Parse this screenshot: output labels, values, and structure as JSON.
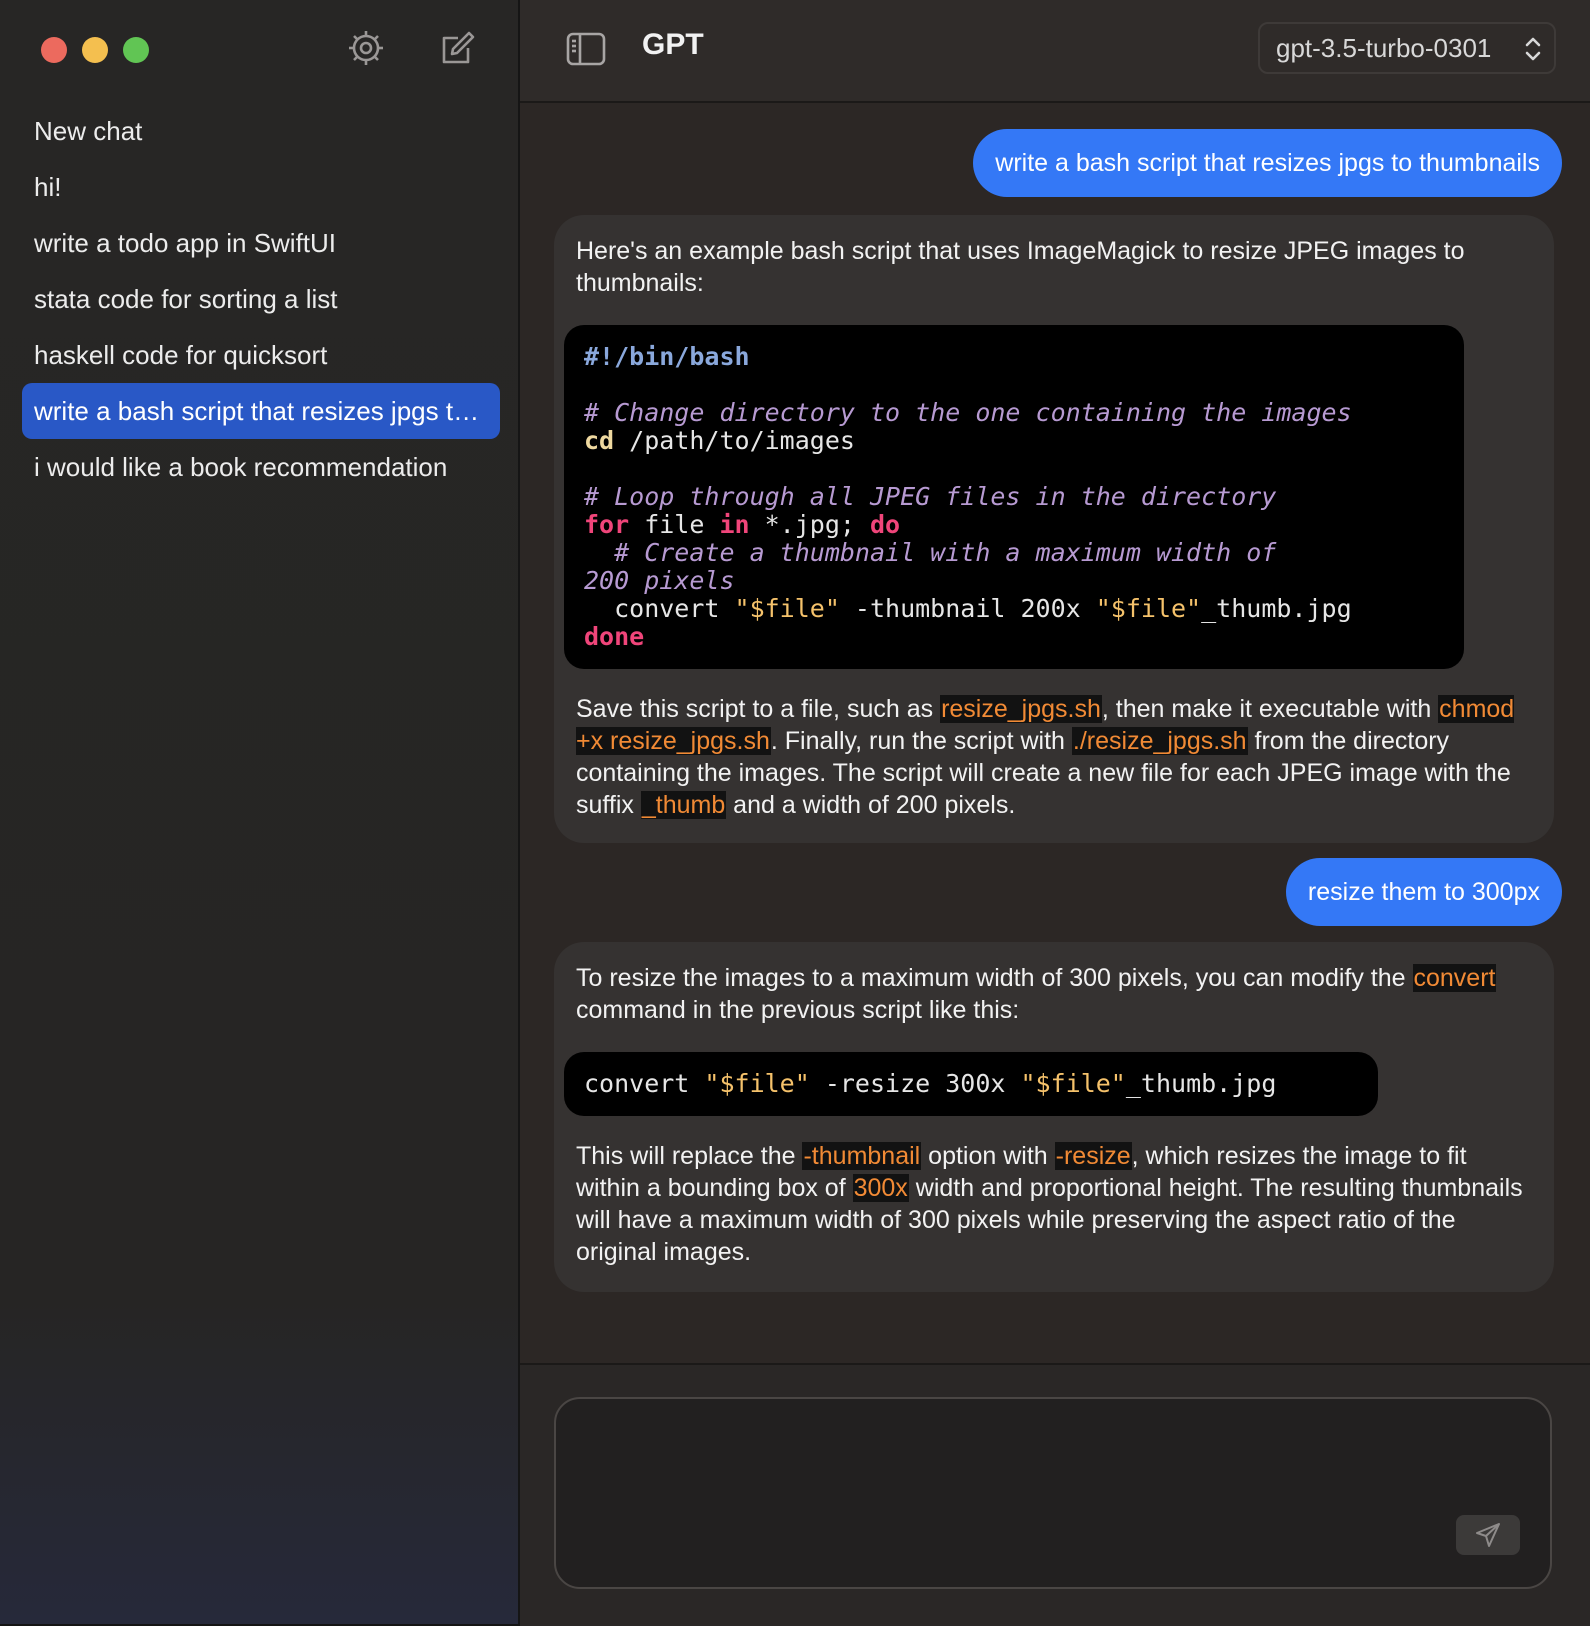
{
  "window": {
    "title": "GPT"
  },
  "sidebar": {
    "icons": [
      "gear-icon",
      "compose-icon"
    ],
    "chats": [
      {
        "label": "New chat",
        "active": false
      },
      {
        "label": "hi!",
        "active": false
      },
      {
        "label": "write a todo app in SwiftUI",
        "active": false
      },
      {
        "label": "stata code for sorting a list",
        "active": false
      },
      {
        "label": "haskell code for quicksort",
        "active": false
      },
      {
        "label": "write a bash script that resizes jpgs to thumbnails",
        "active": true
      },
      {
        "label": "i would like a book recommendation",
        "active": false
      }
    ]
  },
  "header": {
    "title": "GPT",
    "model": "gpt-3.5-turbo-0301"
  },
  "messages": {
    "m1": {
      "role": "user",
      "text": "write a bash script that resizes jpgs to thumbnails"
    },
    "m2": {
      "role": "assistant",
      "intro": "Here's an example bash script that uses ImageMagick to resize JPEG images to thumbnails:",
      "code": {
        "shebang": "#!/bin/bash",
        "comment1": "# Change directory to the one containing the images",
        "cd_cmd": "cd",
        "cd_arg": " /path/to/images",
        "comment2": "# Loop through all JPEG files in the directory",
        "for_kw": "for",
        "for_var": " file ",
        "in_kw": "in",
        "for_glob": " *.jpg; ",
        "do_kw": "do",
        "comment3a": "  # Create a thumbnail with a maximum width of",
        "comment3b": "200 pixels",
        "convert_cmd": "  convert ",
        "str1": "\"$file\"",
        "convert_mid": " -thumbnail 200x ",
        "str2": "\"$file\"",
        "convert_end": "_thumb.jpg",
        "done_kw": "done"
      },
      "outro": {
        "t1": "Save this script to a file, such as ",
        "c1": "resize_jpgs.sh",
        "t2": ", then make it executable with ",
        "c2": "chmod +x resize_jpgs.sh",
        "t3": ". Finally, run the script with ",
        "c3": "./resize_jpgs.sh",
        "t4": " from the directory containing the images. The script will create a new file for each JPEG image with the suffix ",
        "c4": "_thumb",
        "t5": " and a width of 200 pixels."
      }
    },
    "m3": {
      "role": "user",
      "text": "resize them to 300px"
    },
    "m4": {
      "role": "assistant",
      "intro": {
        "t1": "To resize the images to a maximum width of 300 pixels, you can modify the ",
        "c1": "convert",
        "t2": " command in the previous script like this:"
      },
      "code": {
        "cmd": "convert ",
        "str1": "\"$file\"",
        "mid": " -resize 300x ",
        "str2": "\"$file\"",
        "end": "_thumb.jpg"
      },
      "outro": {
        "t1": "This will replace the ",
        "c1": "-thumbnail",
        "t2": " option with ",
        "c2": "-resize",
        "t3": ", which resizes the image to fit within a bounding box of ",
        "c3": "300x",
        "t4": " width and proportional height. The resulting thumbnails will have a maximum width of 300 pixels while preserving the aspect ratio of the original images."
      }
    }
  },
  "composer": {
    "value": "",
    "send_icon": "paper-plane-icon"
  },
  "colors": {
    "accent": "#3478f6",
    "sidebar_selected": "#2958c6",
    "inline_code": "#f18a35"
  }
}
